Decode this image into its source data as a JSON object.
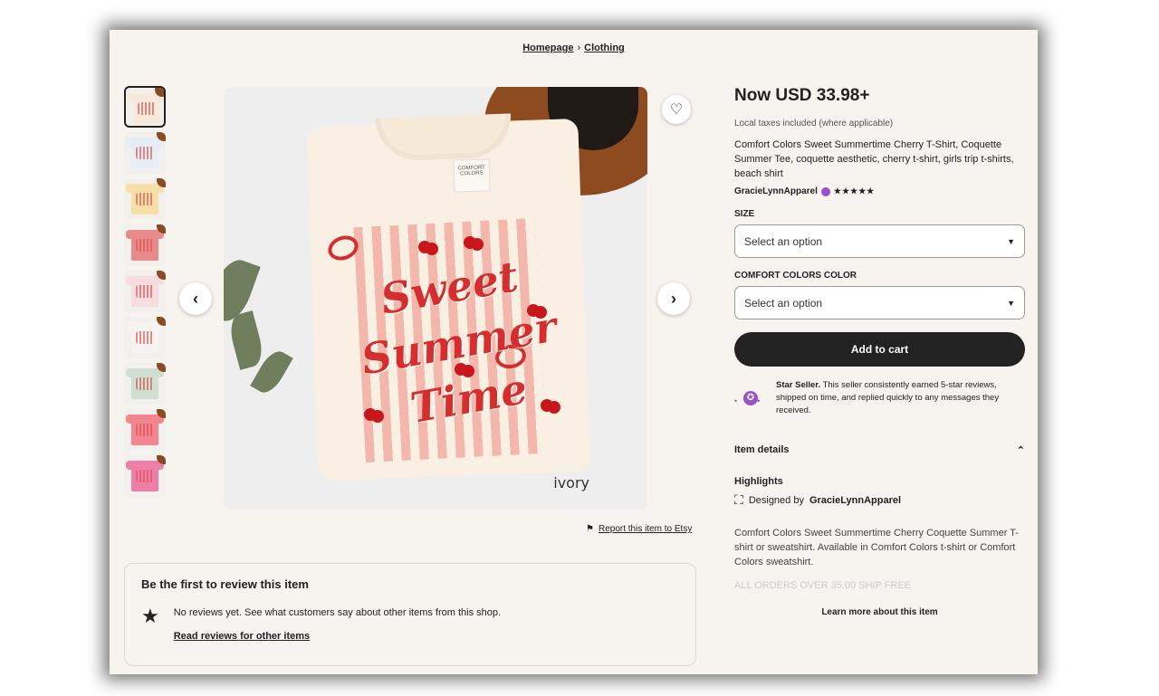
{
  "breadcrumb": {
    "home": "Homepage",
    "sep": "›",
    "category": "Clothing"
  },
  "thumbnails": [
    {
      "color": "#f7eadb"
    },
    {
      "color": "#e7edf5"
    },
    {
      "color": "#f7e0a8"
    },
    {
      "color": "#e98a8a"
    },
    {
      "color": "#f7dde0"
    },
    {
      "color": "#f6f3f0"
    },
    {
      "color": "#cfe0d3"
    },
    {
      "color": "#f3858e"
    },
    {
      "color": "#ee7fa8"
    }
  ],
  "main_image": {
    "label_tag": "COMFORT COLORS",
    "print_lines": [
      "Sweet",
      "Summer",
      "Time"
    ],
    "color_caption": "ivory"
  },
  "icons": {
    "favorite": "heart-icon",
    "prev": "chevron-left-icon",
    "next": "chevron-right-icon",
    "flag": "flag-icon",
    "star": "star-icon"
  },
  "report": {
    "label": "Report this item to Etsy"
  },
  "reviews": {
    "title": "Be the first to review this item",
    "body": "No reviews yet. See what customers say about other items from this shop.",
    "link": "Read reviews for other items"
  },
  "product": {
    "price": "Now USD 33.98+",
    "tax_note": "Local taxes included (where applicable)",
    "title": "Comfort Colors Sweet Summertime Cherry T-Shirt, Coquette Summer Tee, coquette aesthetic, cherry t-shirt, girls trip t-shirts, beach shirt",
    "seller": "GracieLynnApparel",
    "stars": "★★★★★",
    "size_label": "SIZE",
    "size_placeholder": "Select an option",
    "color_label": "COMFORT COLORS COLOR",
    "color_placeholder": "Select an option",
    "add_to_cart": "Add to cart",
    "star_seller_bold": "Star Seller.",
    "star_seller_text": "This seller consistently earned 5-star reviews, shipped on time, and replied quickly to any messages they received.",
    "item_details": "Item details",
    "highlights": "Highlights",
    "designed_by_prefix": "Designed by",
    "designed_by_name": "GracieLynnApparel",
    "description": "Comfort Colors Sweet Summertime Cherry Coquette Summer T-shirt or sweatshirt. Available in Comfort Colors t-shirt or Comfort Colors sweatshirt.",
    "faded_line": "ALL ORDERS OVER 35.00 SHIP FREE",
    "learn_more": "Learn more about this item"
  },
  "colors": {
    "accent_dark": "#222222",
    "star_seller_purple": "#9a50c8",
    "background": "#f7f4ef"
  }
}
